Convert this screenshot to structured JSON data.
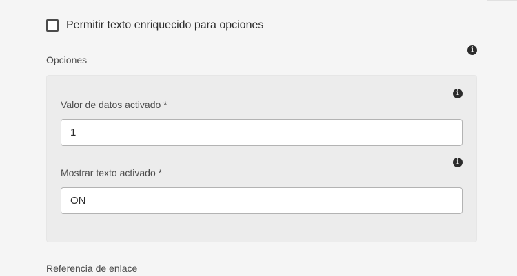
{
  "rich_text": {
    "label": "Permitir texto enriquecido para opciones",
    "checked": false
  },
  "options": {
    "label": "Opciones",
    "info_icon": "info-icon"
  },
  "fields": [
    {
      "label": "Valor de datos activado *",
      "value": "1",
      "info_icon": "info-icon"
    },
    {
      "label": "Mostrar texto activado *",
      "value": "ON",
      "info_icon": "info-icon"
    }
  ],
  "link_reference": {
    "label": "Referencia de enlace"
  }
}
